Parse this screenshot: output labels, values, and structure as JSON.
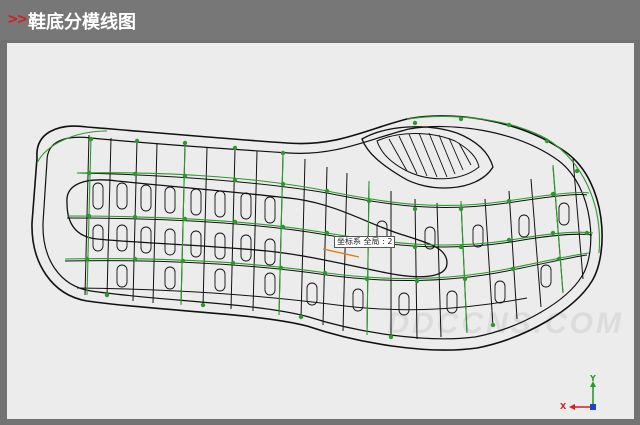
{
  "header": {
    "chevrons": ">>",
    "title": "鞋底分模线图",
    "accent_color": "#d42020"
  },
  "viewport": {
    "background": "#ececec",
    "watermark": "DDCCNS.COM",
    "coordinate_system_label": "坐标系 全局 : 2"
  },
  "triad": {
    "x_label": "X",
    "y_label": "Y",
    "x_color": "#d42020",
    "y_color": "#2a9a2a",
    "z_color": "#2040d0"
  },
  "icons": [
    "chevron-right-icon",
    "coordinate-triad-icon"
  ]
}
